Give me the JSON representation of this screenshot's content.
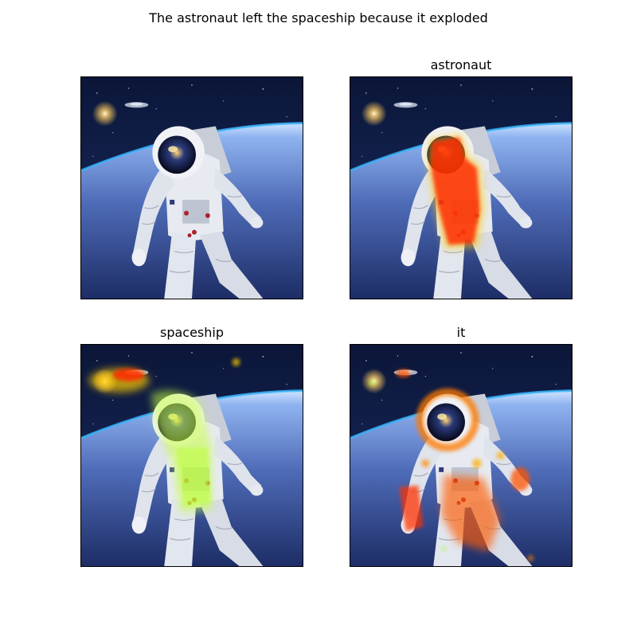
{
  "figure": {
    "title": "The astronaut left the spaceship because it exploded"
  },
  "panels": [
    {
      "title": "",
      "heatmap": "none"
    },
    {
      "title": "astronaut",
      "heatmap": "astronaut-body"
    },
    {
      "title": "spaceship",
      "heatmap": "spaceship-and-chest"
    },
    {
      "title": "it",
      "heatmap": "scattered-edges"
    }
  ],
  "colors": {
    "heat_high": "#ff2200",
    "heat_mid": "#ffaa00",
    "heat_low": "#aaff44",
    "space": "#0a1535",
    "earth": "#6f8fd6"
  }
}
